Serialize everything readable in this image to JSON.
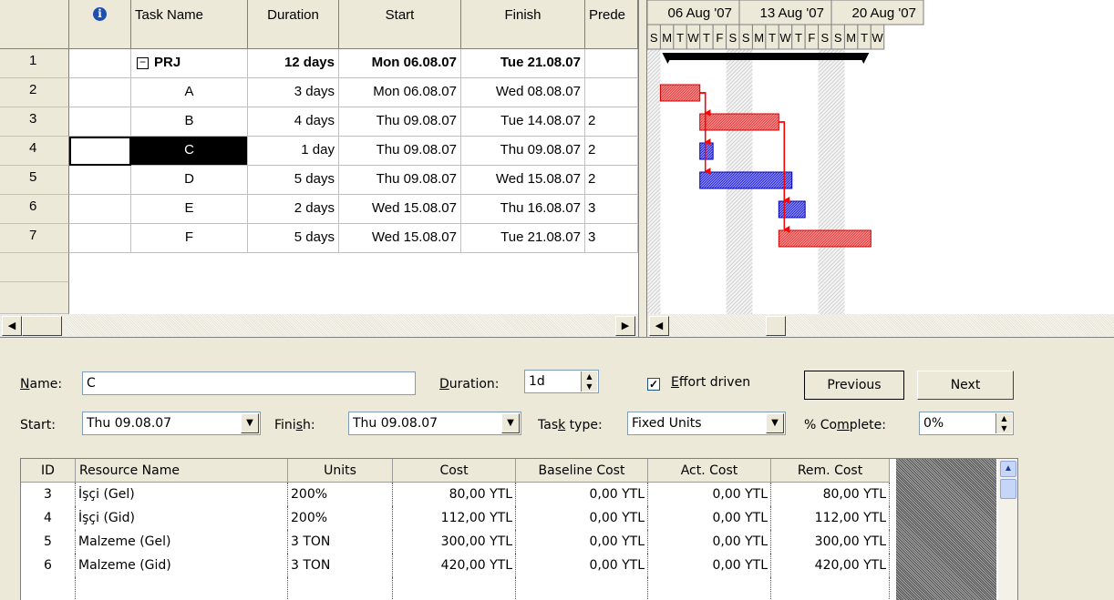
{
  "task_table": {
    "columns": {
      "info": "i",
      "task_name": "Task Name",
      "duration": "Duration",
      "start": "Start",
      "finish": "Finish",
      "predecessors": "Prede"
    },
    "rows": [
      {
        "id": "1",
        "name": "PRJ",
        "duration": "12 days",
        "start": "Mon 06.08.07",
        "finish": "Tue 21.08.07",
        "pred": "",
        "summary": true
      },
      {
        "id": "2",
        "name": "A",
        "duration": "3 days",
        "start": "Mon 06.08.07",
        "finish": "Wed 08.08.07",
        "pred": ""
      },
      {
        "id": "3",
        "name": "B",
        "duration": "4 days",
        "start": "Thu 09.08.07",
        "finish": "Tue 14.08.07",
        "pred": "2"
      },
      {
        "id": "4",
        "name": "C",
        "duration": "1 day",
        "start": "Thu 09.08.07",
        "finish": "Thu 09.08.07",
        "pred": "2",
        "selected": true
      },
      {
        "id": "5",
        "name": "D",
        "duration": "5 days",
        "start": "Thu 09.08.07",
        "finish": "Wed 15.08.07",
        "pred": "2"
      },
      {
        "id": "6",
        "name": "E",
        "duration": "2 days",
        "start": "Wed 15.08.07",
        "finish": "Thu 16.08.07",
        "pred": "3"
      },
      {
        "id": "7",
        "name": "F",
        "duration": "5 days",
        "start": "Wed 15.08.07",
        "finish": "Tue 21.08.07",
        "pred": "3"
      }
    ],
    "collapse_glyph": "−"
  },
  "gantt": {
    "weeks": [
      "06 Aug '07",
      "13 Aug '07",
      "20 Aug '07"
    ],
    "days": [
      "S",
      "M",
      "T",
      "W",
      "T",
      "F",
      "S",
      "S",
      "M",
      "T",
      "W",
      "T",
      "F",
      "S",
      "S",
      "M",
      "T",
      "W"
    ],
    "colors": {
      "critical": "#f06a6a",
      "noncritical": "#6a6af0",
      "link": "#ff0000",
      "summary": "#000000"
    }
  },
  "form": {
    "name_label": "Name:",
    "name_value": "C",
    "duration_label": "Duration:",
    "duration_value": "1d",
    "effort_driven_label": "Effort driven",
    "effort_driven_checked": true,
    "previous_label": "Previous",
    "next_label": "Next",
    "start_label": "Start:",
    "start_value": "Thu 09.08.07",
    "finish_label": "Finish:",
    "finish_value": "Thu 09.08.07",
    "task_type_label": "Task type:",
    "task_type_value": "Fixed Units",
    "percent_label": "% Complete:",
    "percent_value": "0%"
  },
  "resources": {
    "columns": [
      "ID",
      "Resource Name",
      "Units",
      "Cost",
      "Baseline Cost",
      "Act. Cost",
      "Rem. Cost"
    ],
    "rows": [
      {
        "id": "3",
        "name": "İşçi (Gel)",
        "units": "200%",
        "cost": "80,00 YTL",
        "baseline": "0,00 YTL",
        "act": "0,00 YTL",
        "rem": "80,00 YTL"
      },
      {
        "id": "4",
        "name": "İşçi (Gid)",
        "units": "200%",
        "cost": "112,00 YTL",
        "baseline": "0,00 YTL",
        "act": "0,00 YTL",
        "rem": "112,00 YTL"
      },
      {
        "id": "5",
        "name": "Malzeme (Gel)",
        "units": "3 TON",
        "cost": "300,00 YTL",
        "baseline": "0,00 YTL",
        "act": "0,00 YTL",
        "rem": "300,00 YTL"
      },
      {
        "id": "6",
        "name": "Malzeme (Gid)",
        "units": "3 TON",
        "cost": "420,00 YTL",
        "baseline": "0,00 YTL",
        "act": "0,00 YTL",
        "rem": "420,00 YTL"
      }
    ]
  }
}
